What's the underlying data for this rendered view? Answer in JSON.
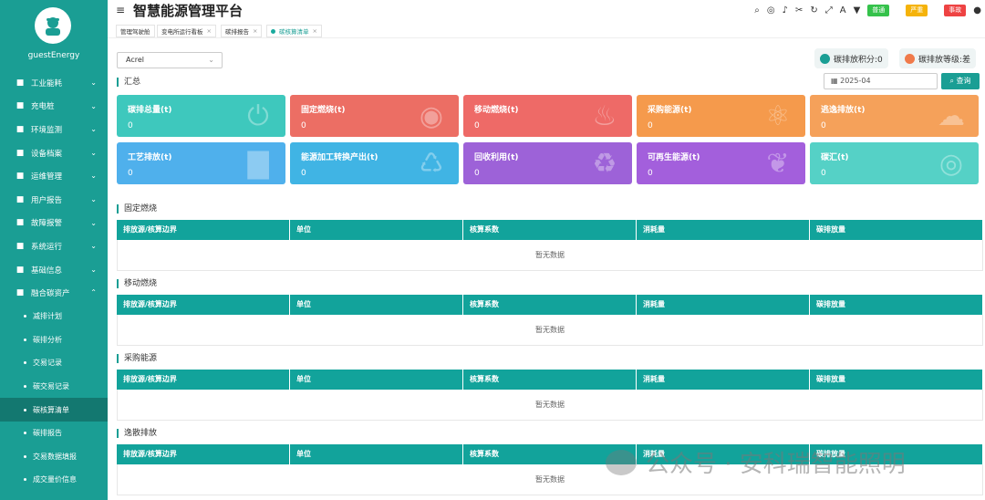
{
  "sidebar": {
    "user": "guestEnergy",
    "items": [
      {
        "label": "工业能耗",
        "icon": "factory-icon"
      },
      {
        "label": "充电桩",
        "icon": "charger-icon"
      },
      {
        "label": "环境监测",
        "icon": "monitor-icon"
      },
      {
        "label": "设备档案",
        "icon": "archive-icon"
      },
      {
        "label": "运维管理",
        "icon": "tool-icon"
      },
      {
        "label": "用户报告",
        "icon": "report-icon"
      },
      {
        "label": "故障报警",
        "icon": "alarm-icon"
      },
      {
        "label": "系统运行",
        "icon": "system-icon"
      },
      {
        "label": "基础信息",
        "icon": "info-icon"
      },
      {
        "label": "融合碳资产",
        "icon": "carbon-icon"
      }
    ],
    "subitems": [
      "减排计划",
      "碳排分析",
      "交易记录",
      "碳交易记录",
      "碳核算清单",
      "碳排报告",
      "交易数据填报",
      "成交量价信息"
    ],
    "active_sub": "碳核算清单"
  },
  "header": {
    "title": "智慧能源管理平台",
    "badges": [
      {
        "label": "普通",
        "color": "#35c24b"
      },
      {
        "label": "严重",
        "color": "#f5b30a"
      },
      {
        "label": "事故",
        "color": "#ee4343"
      }
    ]
  },
  "tabs": [
    {
      "label": "管理驾驶舱"
    },
    {
      "label": "变电所运行看板"
    },
    {
      "label": "碳排报告"
    },
    {
      "label": "碳核算清单"
    }
  ],
  "filter": {
    "select_value": "Acrel",
    "date": "2025-04",
    "query_button": "查询"
  },
  "scores": {
    "points": "碳排放积分:0",
    "level": "碳排放等级:差"
  },
  "summary": {
    "title": "汇总",
    "cards": [
      {
        "label": "碳排总量(t)",
        "value": "0",
        "color": "#3ec8bd"
      },
      {
        "label": "固定燃烧(t)",
        "value": "0",
        "color": "#ec6e64"
      },
      {
        "label": "移动燃烧(t)",
        "value": "0",
        "color": "#ee6a67"
      },
      {
        "label": "采购能源(t)",
        "value": "0",
        "color": "#f59a4c"
      },
      {
        "label": "逃逸排放(t)",
        "value": "0",
        "color": "#f5a15a"
      },
      {
        "label": "工艺排放(t)",
        "value": "0",
        "color": "#4fb0ec"
      },
      {
        "label": "能源加工转换产出(t)",
        "value": "0",
        "color": "#40b4e4"
      },
      {
        "label": "回收利用(t)",
        "value": "0",
        "color": "#9d62d8"
      },
      {
        "label": "可再生能源(t)",
        "value": "0",
        "color": "#a35fdc"
      },
      {
        "label": "碳汇(t)",
        "value": "0",
        "color": "#55d1c6"
      }
    ]
  },
  "tables": [
    {
      "title": "固定燃烧",
      "empty": "暂无数据"
    },
    {
      "title": "移动燃烧",
      "empty": "暂无数据"
    },
    {
      "title": "采购能源",
      "empty": "暂无数据"
    },
    {
      "title": "逸散排放",
      "empty": "暂无数据"
    }
  ],
  "columns": [
    "排放源/核算边界",
    "单位",
    "核算系数",
    "消耗量",
    "碳排放量"
  ],
  "watermark": "公众号 · 安科瑞智能照明"
}
